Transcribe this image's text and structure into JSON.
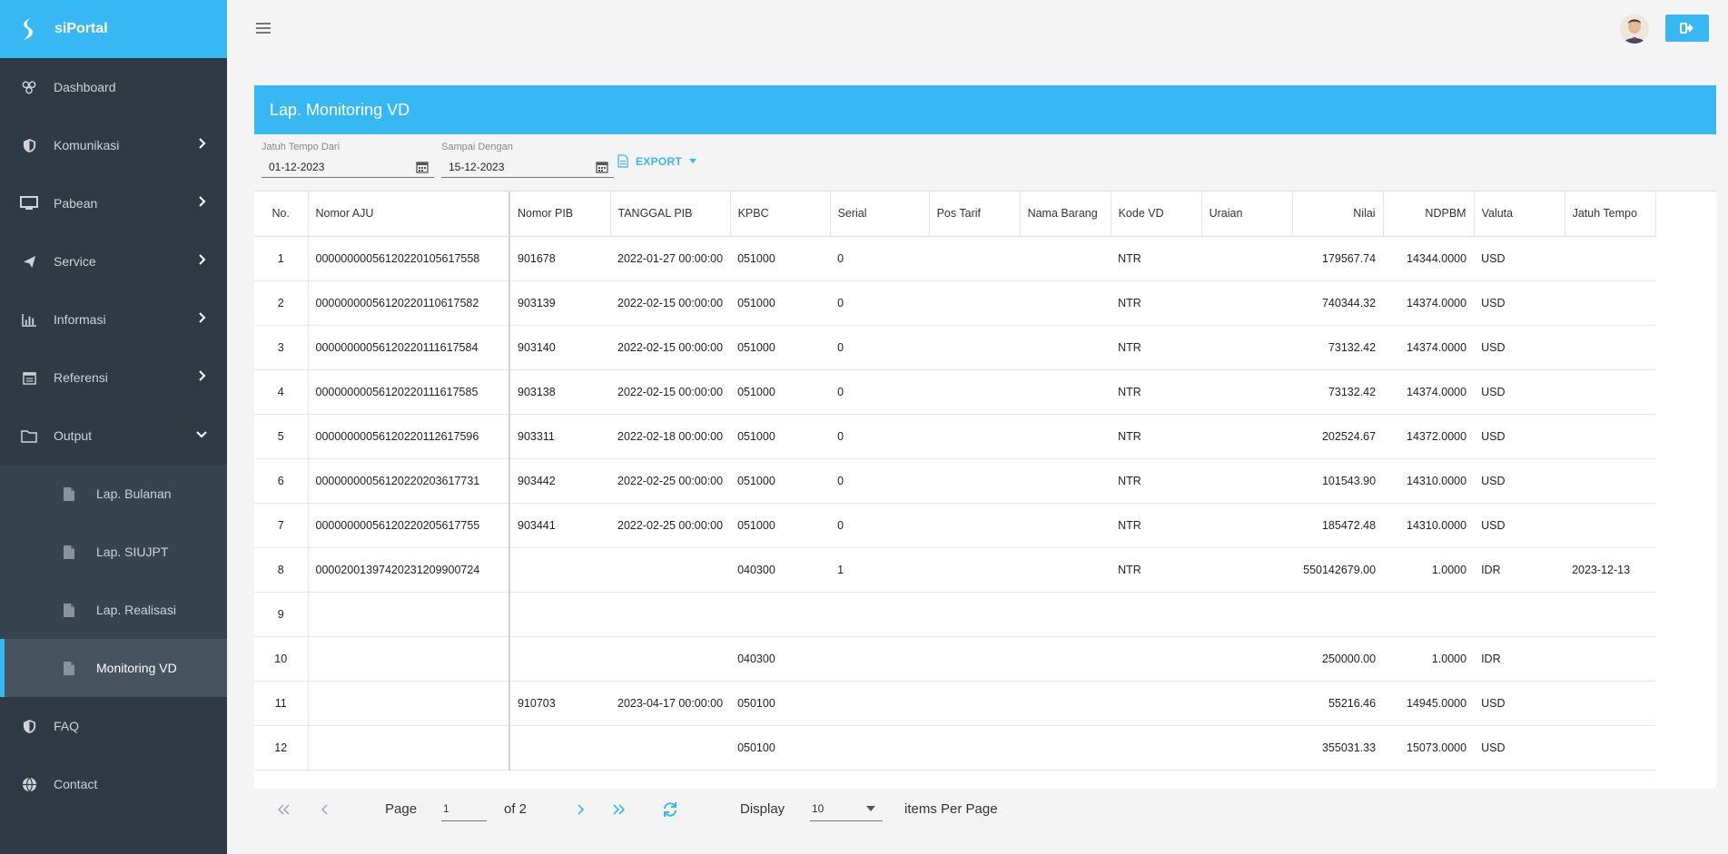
{
  "brand": {
    "name": "siPortal"
  },
  "nav": [
    {
      "label": "Dashboard",
      "icon": "dashboard-icon",
      "chevron": ""
    },
    {
      "label": "Komunikasi",
      "icon": "shield-icon",
      "chevron": "right"
    },
    {
      "label": "Pabean",
      "icon": "monitor-icon",
      "chevron": "right"
    },
    {
      "label": "Service",
      "icon": "send-icon",
      "chevron": "right"
    },
    {
      "label": "Informasi",
      "icon": "bar-chart-icon",
      "chevron": "right"
    },
    {
      "label": "Referensi",
      "icon": "calendar-list-icon",
      "chevron": "right"
    },
    {
      "label": "Output",
      "icon": "folder-icon",
      "chevron": "down"
    }
  ],
  "subnav": [
    {
      "label": "Lap. Bulanan",
      "icon": "file-icon"
    },
    {
      "label": "Lap. SIUJPT",
      "icon": "file-icon"
    },
    {
      "label": "Lap. Realisasi",
      "icon": "file-icon"
    },
    {
      "label": "Monitoring VD",
      "icon": "file-icon",
      "active": true
    }
  ],
  "nav_bottom": [
    {
      "label": "FAQ",
      "icon": "shield-icon"
    },
    {
      "label": "Contact",
      "icon": "globe-icon"
    }
  ],
  "panel": {
    "title": "Lap. Monitoring VD"
  },
  "filters": {
    "from_label": "Jatuh Tempo Dari",
    "from_value": "01-12-2023",
    "to_label": "Sampai Dengan",
    "to_value": "15-12-2023",
    "export_label": "EXPORT"
  },
  "table": {
    "columns": [
      "No.",
      "Nomor AJU",
      "Nomor PIB",
      "TANGGAL PIB",
      "KPBC",
      "Serial",
      "Pos Tarif",
      "Nama Barang",
      "Kode VD",
      "Uraian",
      "Nilai",
      "NDPBM",
      "Valuta",
      "Jatuh Tempo"
    ],
    "rows": [
      [
        "1",
        "000000000561202201056 17558",
        "901678",
        "2022-01-27 00:00:00",
        "051000",
        "0",
        "",
        "",
        "NTR",
        "",
        "179567.74",
        "14344.0000",
        "USD",
        ""
      ],
      [
        "2",
        "00000000056120220110617582",
        "903139",
        "2022-02-15 00:00:00",
        "051000",
        "0",
        "",
        "",
        "NTR",
        "",
        "740344.32",
        "14374.0000",
        "USD",
        ""
      ],
      [
        "3",
        "00000000056120220111617584",
        "903140",
        "2022-02-15 00:00:00",
        "051000",
        "0",
        "",
        "",
        "NTR",
        "",
        "73132.42",
        "14374.0000",
        "USD",
        ""
      ],
      [
        "4",
        "00000000056120220111617585",
        "903138",
        "2022-02-15 00:00:00",
        "051000",
        "0",
        "",
        "",
        "NTR",
        "",
        "73132.42",
        "14374.0000",
        "USD",
        ""
      ],
      [
        "5",
        "00000000056120220112617596",
        "903311",
        "2022-02-18 00:00:00",
        "051000",
        "0",
        "",
        "",
        "NTR",
        "",
        "202524.67",
        "14372.0000",
        "USD",
        ""
      ],
      [
        "6",
        "00000000056120220203617731",
        "903442",
        "2022-02-25 00:00:00",
        "051000",
        "0",
        "",
        "",
        "NTR",
        "",
        "101543.90",
        "14310.0000",
        "USD",
        ""
      ],
      [
        "7",
        "00000000056120220205617755",
        "903441",
        "2022-02-25 00:00:00",
        "051000",
        "0",
        "",
        "",
        "NTR",
        "",
        "185472.48",
        "14310.0000",
        "USD",
        ""
      ],
      [
        "8",
        "00002001397420231209900724",
        "",
        "",
        "040300",
        "1",
        "",
        "",
        "NTR",
        "",
        "550142679.00",
        "1.0000",
        "IDR",
        "2023-12-13"
      ],
      [
        "9",
        "",
        "",
        "",
        "",
        "",
        "",
        "",
        "",
        "",
        "",
        "",
        "",
        ""
      ],
      [
        "10",
        "",
        "",
        "",
        "040300",
        "",
        "",
        "",
        "",
        "",
        "250000.00",
        "1.0000",
        "IDR",
        ""
      ],
      [
        "11",
        "",
        "910703",
        "2023-04-17 00:00:00",
        "050100",
        "",
        "",
        "",
        "",
        "",
        "55216.46",
        "14945.0000",
        "USD",
        ""
      ],
      [
        "12",
        "",
        "",
        "",
        "050100",
        "",
        "",
        "",
        "",
        "",
        "355031.33",
        "15073.0000",
        "USD",
        ""
      ]
    ]
  },
  "pager": {
    "page_label": "Page",
    "page_value": "1",
    "of_label": "of 2",
    "display_label": "Display",
    "page_size": "10",
    "per_page_label": "items Per Page"
  },
  "colors": {
    "accent": "#38b8f2",
    "sidebar": "#2f3a44"
  }
}
